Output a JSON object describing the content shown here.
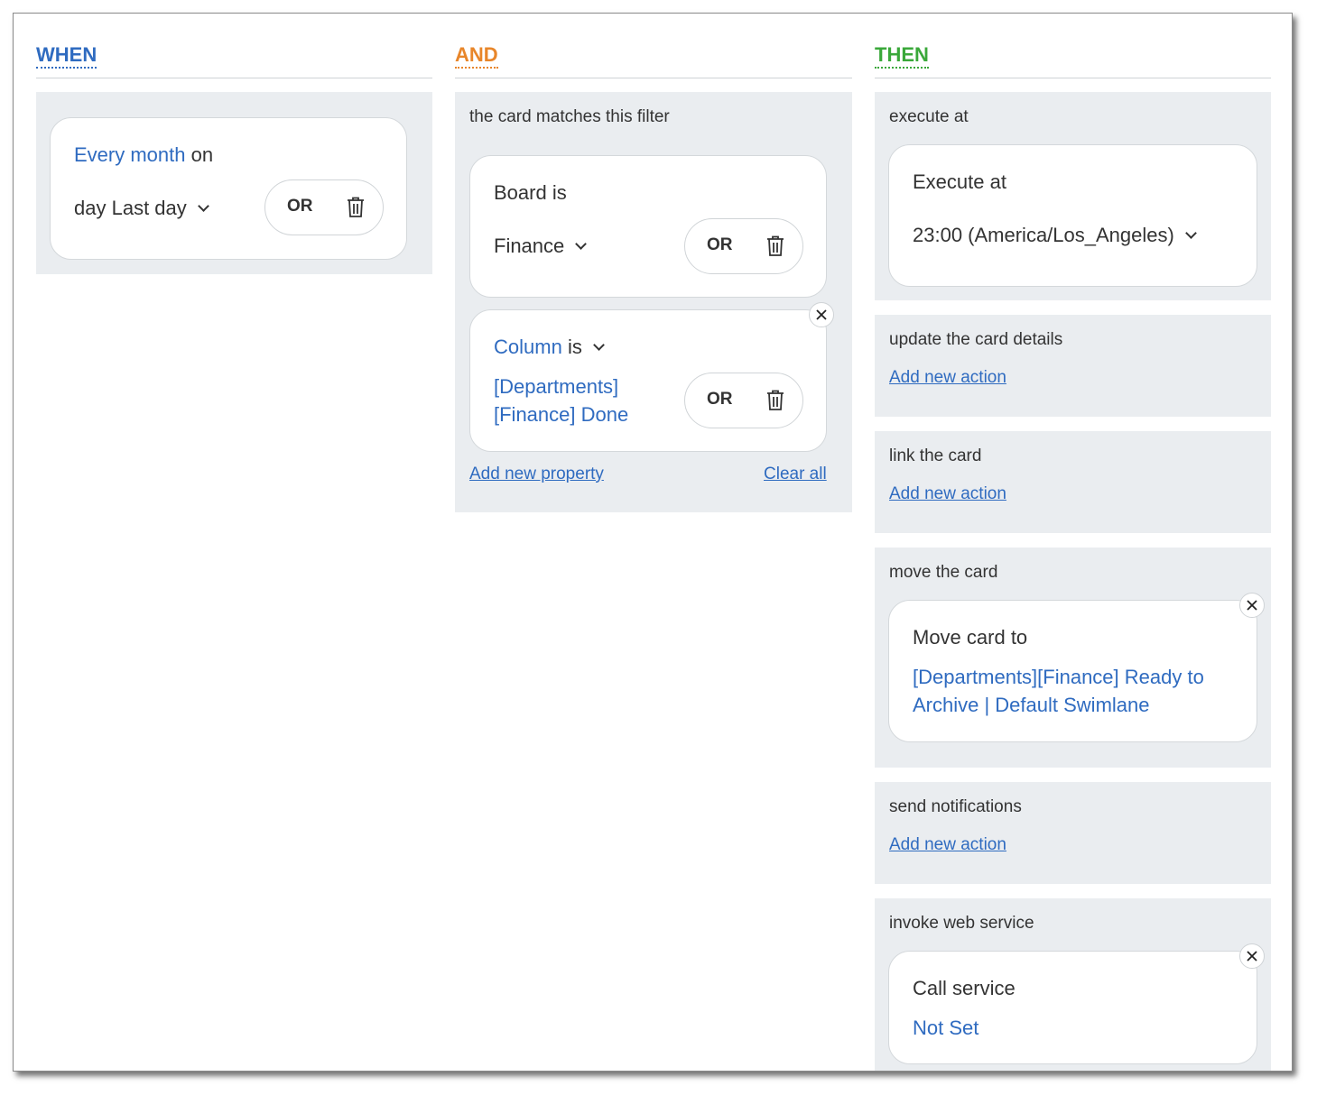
{
  "columns": {
    "when": {
      "title": "WHEN"
    },
    "and": {
      "title": "AND"
    },
    "then": {
      "title": "THEN"
    }
  },
  "when_card": {
    "frequency": "Every month",
    "on": "on",
    "day_prefix": "day",
    "day_value": "Last day",
    "or_label": "OR"
  },
  "and_panel": {
    "label": "the card matches this filter",
    "board_card": {
      "title": "Board is",
      "value": "Finance",
      "or_label": "OR"
    },
    "column_card": {
      "field": "Column",
      "is": "is",
      "value_line1": "[Departments]",
      "value_line2": "[Finance] Done",
      "or_label": "OR"
    },
    "add_property": "Add new property",
    "clear_all": "Clear all"
  },
  "then_panels": {
    "execute": {
      "label": "execute at",
      "card_title": "Execute at",
      "value": "23:00 (America/Los_Angeles)"
    },
    "update": {
      "label": "update the card details",
      "link": "Add new action"
    },
    "link_card": {
      "label": "link the card",
      "link": "Add new action"
    },
    "move": {
      "label": "move the card",
      "card_title": "Move card to",
      "value_line1": "[Departments][Finance] Ready to",
      "value_line2": "Archive | Default Swimlane"
    },
    "notify": {
      "label": "send notifications",
      "link": "Add new action"
    },
    "webservice": {
      "label": "invoke web service",
      "card_title": "Call service",
      "value": "Not Set"
    }
  }
}
